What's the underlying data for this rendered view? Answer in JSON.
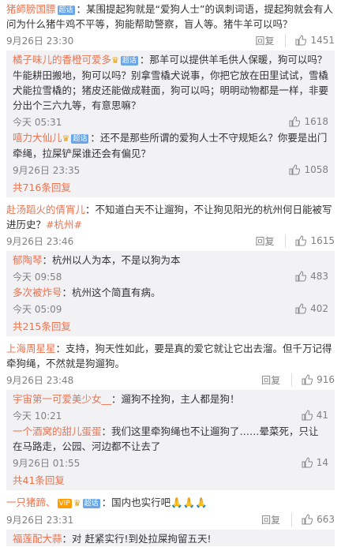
{
  "comments": [
    {
      "user": "猪師膀国膘",
      "text": "某围提起狗就是“爱狗人士”的讽刺词语，提起狗就会有人问为什么猪牛鸡不平等，狗能帮助警察，盲人等。猪牛羊可以吗？",
      "time": "9月26日 23:30",
      "reply": "回复",
      "likes": "1451",
      "replies": [
        {
          "user": "橘子味儿的香橙可爱多",
          "text": "那羊可以提供羊毛供人保暖，狗可以吗？牛能耕田搬地，狗可以吗？别拿雪橇犬说事，你把它放在田里试试，雪橇犬能拉雪橇的；猪皮还能做成鞋面，狗可以吗；明明动物都是一样，非要分出个三六九等，有意思嘛？",
          "time": "今天 05:31",
          "likes": "1618"
        },
        {
          "user": "嘻力大仙儿",
          "text": "还不是那些所谓的爱狗人士不守规矩么？你要是出门牵绳，拉屎铲屎谁还会有偏见？",
          "time": "9月26日 23:35",
          "likes": "1058"
        }
      ],
      "more": "共716条回复"
    },
    {
      "user": "赴汤蹈火的倩宵儿",
      "text": "不知道白天不让遛狗，不让狗见阳光的杭州何日能被写进历史？",
      "tag": "#杭州#",
      "time": "9月26日 23:46",
      "reply": "回复",
      "likes": "1615",
      "replies": [
        {
          "user": "郁陶琴",
          "text": "杭州以人为本，不是以狗为本",
          "time": "今天 09:58",
          "likes": "483"
        },
        {
          "user": "多次被炸号",
          "text": "杭州这个简直有病。",
          "time": "今天 05:09",
          "likes": "402"
        }
      ],
      "more": "共215条回复"
    },
    {
      "user": "上海周星星",
      "text": "支持，狗天性如此，要是真的爱它就让它出去溜。但千万记得牵狗绳，不然就是狗遛狗。",
      "time": "9月26日 23:48",
      "reply": "回复",
      "likes": "916",
      "replies": [
        {
          "user": "宇宙第一可爱美少女__",
          "text": "遛狗不拴狗，主人都是狗！",
          "time": "今天 10:21",
          "likes": "41"
        },
        {
          "user": "一个酒窝的甜儿蛋蛋",
          "text": "我们这里牵狗绳也不让遛狗了……晕菜死，只让在马路走，公园、河边都不让去了",
          "time": "9月26日 01:55",
          "likes": "14"
        }
      ],
      "more": "共41条回复"
    },
    {
      "user": "一只猪蹄、",
      "text": "国内也实行吧",
      "emoji": "🙏🙏🙏",
      "time": "9月26日 23:31",
      "reply": "回复",
      "likes": "663"
    },
    {
      "user": "福莲配大蒜",
      "text": "对  赶紧实行!到处拉屎拘留五天!"
    }
  ],
  "badges": {
    "vip": "超话",
    "member": "VIP"
  },
  "colors": {
    "username": "#eb7350",
    "meta": "#808080",
    "subbg": "#f2f2f5"
  }
}
